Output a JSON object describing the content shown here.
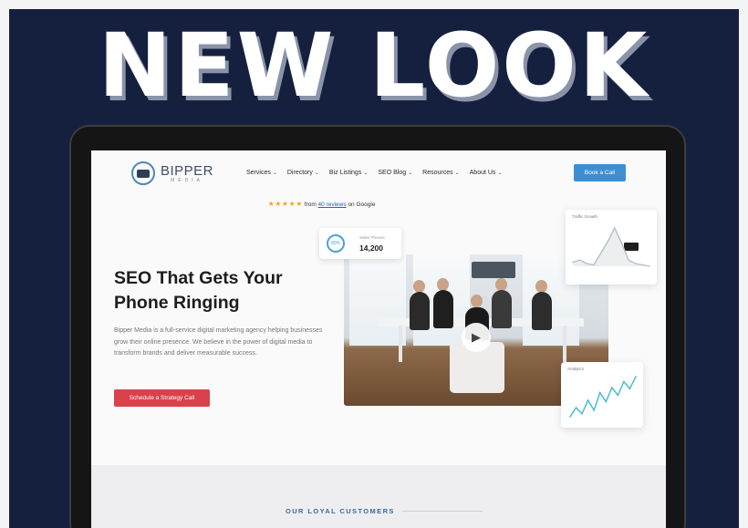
{
  "headline": "NEW LOOK",
  "site": {
    "logo": {
      "name": "BIPPER",
      "sub": "MEDIA"
    },
    "nav": [
      {
        "label": "Services",
        "name": "services"
      },
      {
        "label": "Directory",
        "name": "directory"
      },
      {
        "label": "Biz Listings",
        "name": "biz-listings"
      },
      {
        "label": "SEO Blog",
        "name": "seo-blog"
      },
      {
        "label": "Resources",
        "name": "resources"
      },
      {
        "label": "About Us",
        "name": "about-us"
      }
    ],
    "cta_top": "Book a Call",
    "rating": {
      "stars": "★★★★★",
      "prefix": "from",
      "link": "40 reviews",
      "suffix": "on Google"
    },
    "hero": {
      "title_line1": "SEO That Gets Your",
      "title_line2": "Phone Ringing",
      "description": "Bipper Media is a full-service digital marketing agency helping businesses grow their online presence. We believe in the power of digital media to transform brands and deliver measurable success.",
      "cta": "Schedule a Strategy Call"
    },
    "stat_card": {
      "ring": "80%",
      "label": "Sales Phones",
      "value": "14,200"
    },
    "traffic_card": {
      "title": "Traffic Growth",
      "series": [
        42,
        45,
        40,
        38,
        55,
        72,
        92,
        70,
        45,
        40,
        38,
        36
      ]
    },
    "analytics_card": {
      "title": "Analytics",
      "series": [
        12,
        30,
        18,
        45,
        25,
        60,
        42,
        70,
        55,
        82,
        68,
        92
      ]
    },
    "section_heading": "OUR LOYAL CUSTOMERS"
  },
  "colors": {
    "background": "#15203f",
    "primary": "#3e8ed2",
    "accent_red": "#d9424b",
    "star": "#f4a62a"
  }
}
